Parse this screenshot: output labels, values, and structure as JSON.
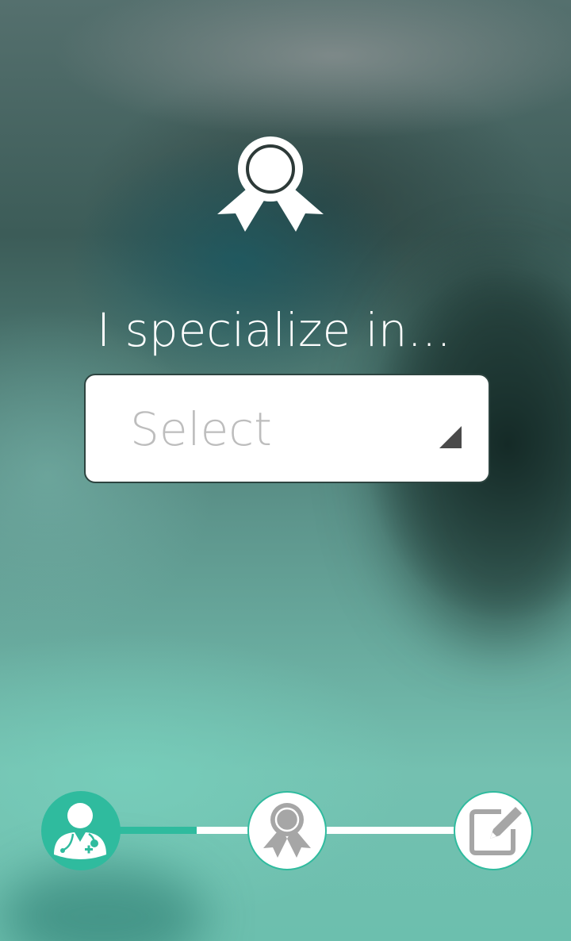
{
  "onboarding": {
    "heading": "I specialize in...",
    "hero_icon": "ribbon-award-icon"
  },
  "specialty_select": {
    "placeholder": "Select",
    "arrow_icon": "dropdown-corner-arrow-icon"
  },
  "progress": {
    "current_step": 2,
    "total_steps": 3,
    "steps": [
      {
        "icon": "doctor-icon",
        "state": "completed"
      },
      {
        "icon": "ribbon-award-icon",
        "state": "current"
      },
      {
        "icon": "edit-icon",
        "state": "upcoming"
      }
    ]
  },
  "colors": {
    "accent": "#2fbb9e",
    "white": "#ffffff",
    "icon_gray": "#a6a6a6",
    "placeholder_gray": "#bdbdbd"
  }
}
